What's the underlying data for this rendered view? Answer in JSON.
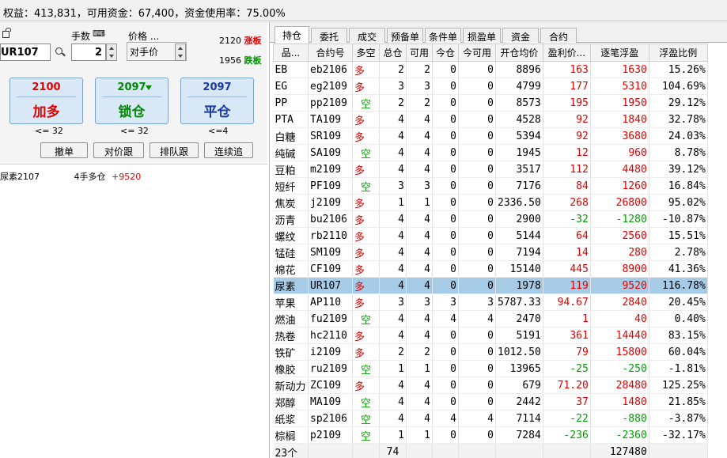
{
  "status_bar": {
    "text": "权益：413,831，可用资金：67,400，资金使用率：75.00%"
  },
  "order_panel": {
    "qty_label": "手数",
    "price_label": "价格 ...",
    "contract_code": "UR107",
    "quantity": "2",
    "price_mode": "对手价",
    "limit_up": {
      "price": "2120",
      "label": "涨板"
    },
    "limit_down": {
      "price": "1956",
      "label": "跌板"
    },
    "buttons": [
      {
        "price": "2100",
        "action": "加多",
        "limit": "<= 32",
        "price_color": "#e00000",
        "action_color": "#e00000"
      },
      {
        "price": "2097",
        "action": "锁仓",
        "limit": "<= 32",
        "price_color": "#008a00",
        "action_color": "#008a00"
      },
      {
        "price": "2097",
        "action": "平仓",
        "limit": "<=4",
        "price_color": "#1a3aa0",
        "action_color": "#1a3aa0"
      }
    ],
    "small_buttons": [
      "撤单",
      "对价跟",
      "排队跟",
      "连续追"
    ],
    "position_summary": {
      "name": "尿素2107",
      "desc": "4手多仓",
      "pnl": "+9520"
    }
  },
  "tabs": [
    "持仓",
    "委托",
    "成交",
    "预备单",
    "条件单",
    "损盈单",
    "资金",
    "合约"
  ],
  "columns": [
    "品...",
    "合约号",
    "多空",
    "总仓",
    "可用",
    "今仓",
    "今可用",
    "开仓均价",
    "盈利价...",
    "逐笔浮盈",
    "浮盈比例"
  ],
  "rows": [
    {
      "name": "EB",
      "code": "eb2106",
      "dir": "多",
      "total": "2",
      "avail": "2",
      "today": "0",
      "today_avail": "0",
      "open_avg": "8896",
      "profit_pts": "163",
      "float_pnl": "1630",
      "ratio": "15.26%",
      "sign": "pos"
    },
    {
      "name": "EG",
      "code": "eg2109",
      "dir": "多",
      "total": "3",
      "avail": "3",
      "today": "0",
      "today_avail": "0",
      "open_avg": "4799",
      "profit_pts": "177",
      "float_pnl": "5310",
      "ratio": "104.69%",
      "sign": "pos"
    },
    {
      "name": "PP",
      "code": "pp2109",
      "dir": "空",
      "total": "2",
      "avail": "2",
      "today": "0",
      "today_avail": "0",
      "open_avg": "8573",
      "profit_pts": "195",
      "float_pnl": "1950",
      "ratio": "29.12%",
      "sign": "pos"
    },
    {
      "name": "PTA",
      "code": "TA109",
      "dir": "多",
      "total": "4",
      "avail": "4",
      "today": "0",
      "today_avail": "0",
      "open_avg": "4528",
      "profit_pts": "92",
      "float_pnl": "1840",
      "ratio": "32.78%",
      "sign": "pos"
    },
    {
      "name": "白糖",
      "code": "SR109",
      "dir": "多",
      "total": "4",
      "avail": "4",
      "today": "0",
      "today_avail": "0",
      "open_avg": "5394",
      "profit_pts": "92",
      "float_pnl": "3680",
      "ratio": "24.03%",
      "sign": "pos"
    },
    {
      "name": "纯碱",
      "code": "SA109",
      "dir": "空",
      "total": "4",
      "avail": "4",
      "today": "0",
      "today_avail": "0",
      "open_avg": "1945",
      "profit_pts": "12",
      "float_pnl": "960",
      "ratio": "8.78%",
      "sign": "pos"
    },
    {
      "name": "豆粕",
      "code": "m2109",
      "dir": "多",
      "total": "4",
      "avail": "4",
      "today": "0",
      "today_avail": "0",
      "open_avg": "3517",
      "profit_pts": "112",
      "float_pnl": "4480",
      "ratio": "39.12%",
      "sign": "pos"
    },
    {
      "name": "短纤",
      "code": "PF109",
      "dir": "空",
      "total": "3",
      "avail": "3",
      "today": "0",
      "today_avail": "0",
      "open_avg": "7176",
      "profit_pts": "84",
      "float_pnl": "1260",
      "ratio": "16.84%",
      "sign": "pos"
    },
    {
      "name": "焦炭",
      "code": "j2109",
      "dir": "多",
      "total": "1",
      "avail": "1",
      "today": "0",
      "today_avail": "0",
      "open_avg": "2336.50",
      "profit_pts": "268",
      "float_pnl": "26800",
      "ratio": "95.02%",
      "sign": "pos"
    },
    {
      "name": "沥青",
      "code": "bu2106",
      "dir": "多",
      "total": "4",
      "avail": "4",
      "today": "0",
      "today_avail": "0",
      "open_avg": "2900",
      "profit_pts": "-32",
      "float_pnl": "-1280",
      "ratio": "-10.87%",
      "sign": "neg"
    },
    {
      "name": "螺纹",
      "code": "rb2110",
      "dir": "多",
      "total": "4",
      "avail": "4",
      "today": "0",
      "today_avail": "0",
      "open_avg": "5144",
      "profit_pts": "64",
      "float_pnl": "2560",
      "ratio": "15.51%",
      "sign": "pos"
    },
    {
      "name": "锰硅",
      "code": "SM109",
      "dir": "多",
      "total": "4",
      "avail": "4",
      "today": "0",
      "today_avail": "0",
      "open_avg": "7194",
      "profit_pts": "14",
      "float_pnl": "280",
      "ratio": "2.78%",
      "sign": "pos"
    },
    {
      "name": "棉花",
      "code": "CF109",
      "dir": "多",
      "total": "4",
      "avail": "4",
      "today": "0",
      "today_avail": "0",
      "open_avg": "15140",
      "profit_pts": "445",
      "float_pnl": "8900",
      "ratio": "41.36%",
      "sign": "pos"
    },
    {
      "name": "尿素",
      "code": "UR107",
      "dir": "多",
      "total": "4",
      "avail": "4",
      "today": "0",
      "today_avail": "0",
      "open_avg": "1978",
      "profit_pts": "119",
      "float_pnl": "9520",
      "ratio": "116.78%",
      "sign": "pos",
      "selected": true
    },
    {
      "name": "苹果",
      "code": "AP110",
      "dir": "多",
      "total": "3",
      "avail": "3",
      "today": "3",
      "today_avail": "3",
      "open_avg": "5787.33",
      "profit_pts": "94.67",
      "float_pnl": "2840",
      "ratio": "20.45%",
      "sign": "pos"
    },
    {
      "name": "燃油",
      "code": "fu2109",
      "dir": "空",
      "total": "4",
      "avail": "4",
      "today": "4",
      "today_avail": "4",
      "open_avg": "2470",
      "profit_pts": "1",
      "float_pnl": "40",
      "ratio": "0.40%",
      "sign": "pos"
    },
    {
      "name": "热卷",
      "code": "hc2110",
      "dir": "多",
      "total": "4",
      "avail": "4",
      "today": "0",
      "today_avail": "0",
      "open_avg": "5191",
      "profit_pts": "361",
      "float_pnl": "14440",
      "ratio": "83.15%",
      "sign": "pos"
    },
    {
      "name": "铁矿",
      "code": "i2109",
      "dir": "多",
      "total": "2",
      "avail": "2",
      "today": "0",
      "today_avail": "0",
      "open_avg": "1012.50",
      "profit_pts": "79",
      "float_pnl": "15800",
      "ratio": "60.04%",
      "sign": "pos"
    },
    {
      "name": "橡胶",
      "code": "ru2109",
      "dir": "空",
      "total": "1",
      "avail": "1",
      "today": "0",
      "today_avail": "0",
      "open_avg": "13965",
      "profit_pts": "-25",
      "float_pnl": "-250",
      "ratio": "-1.81%",
      "sign": "neg"
    },
    {
      "name": "新动力",
      "code": "ZC109",
      "dir": "多",
      "total": "4",
      "avail": "4",
      "today": "0",
      "today_avail": "0",
      "open_avg": "679",
      "profit_pts": "71.20",
      "float_pnl": "28480",
      "ratio": "125.25%",
      "sign": "pos"
    },
    {
      "name": "郑醇",
      "code": "MA109",
      "dir": "空",
      "total": "4",
      "avail": "4",
      "today": "0",
      "today_avail": "0",
      "open_avg": "2442",
      "profit_pts": "37",
      "float_pnl": "1480",
      "ratio": "21.85%",
      "sign": "pos"
    },
    {
      "name": "纸浆",
      "code": "sp2106",
      "dir": "空",
      "total": "4",
      "avail": "4",
      "today": "4",
      "today_avail": "4",
      "open_avg": "7114",
      "profit_pts": "-22",
      "float_pnl": "-880",
      "ratio": "-3.87%",
      "sign": "neg"
    },
    {
      "name": "棕榈",
      "code": "p2109",
      "dir": "空",
      "total": "1",
      "avail": "1",
      "today": "0",
      "today_avail": "0",
      "open_avg": "7284",
      "profit_pts": "-236",
      "float_pnl": "-2360",
      "ratio": "-32.17%",
      "sign": "neg"
    }
  ],
  "summary": {
    "count": "23个",
    "total": "74",
    "float_pnl": "127480"
  },
  "colors": {
    "profit": "#e00000",
    "loss": "#00a000",
    "selected_row": "#a6cbe6",
    "button_bg": "#d8e8f6"
  }
}
